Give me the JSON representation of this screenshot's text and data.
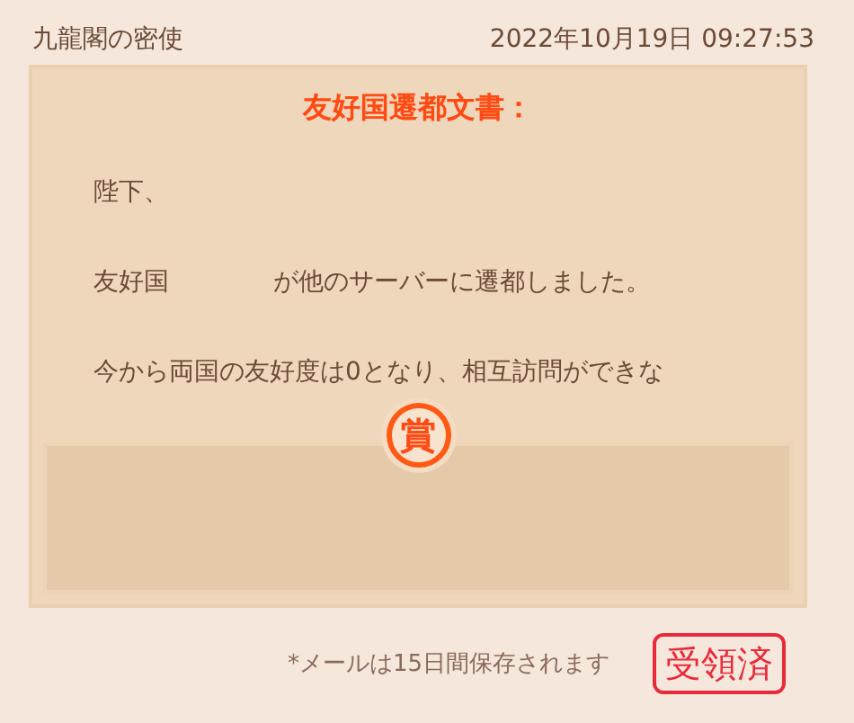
{
  "header": {
    "sender": "九龍閣の密使",
    "datetime": "2022年10月19日 09:27:53"
  },
  "letter": {
    "title": "友好国遷都文書：",
    "lines": [
      [
        "陛下、"
      ],
      [
        "友好国",
        "が他のサーバーに遷都しました。"
      ],
      [
        "今から両国の友好度は0となり、相互訪問ができな"
      ]
    ]
  },
  "reward": {
    "badge": "賞"
  },
  "footer": {
    "note": "*メールは15日間保存されます",
    "status": {
      "label": "受領済",
      "claimed": true
    }
  }
}
